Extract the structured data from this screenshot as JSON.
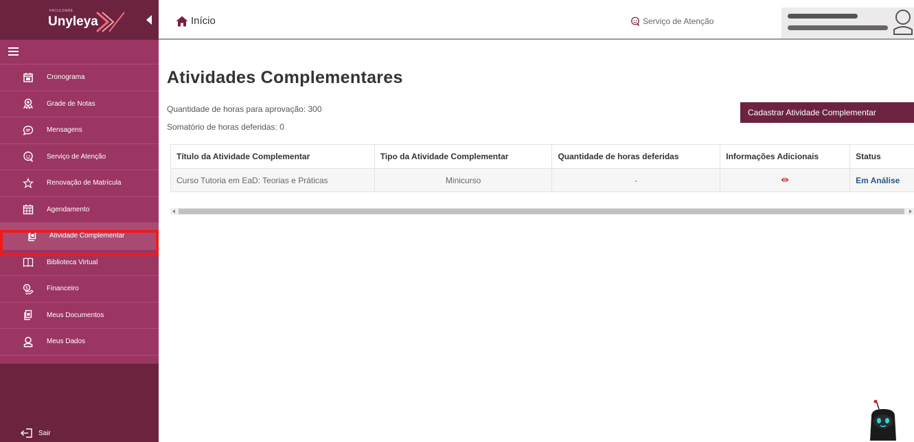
{
  "brand": {
    "small": "FACULDADE",
    "name": "Unyleya"
  },
  "sidebar": {
    "items": [
      {
        "label": "Cronograma",
        "icon": "calendar-icon"
      },
      {
        "label": "Grade de Notas",
        "icon": "award-icon"
      },
      {
        "label": "Mensagens",
        "icon": "chat-icon"
      },
      {
        "label": "Serviço de Atenção",
        "icon": "support-chat-icon"
      },
      {
        "label": "Renovação de Matrícula",
        "icon": "star-icon"
      },
      {
        "label": "Agendamento",
        "icon": "calendar-grid-icon"
      },
      {
        "label": "Atividade Complementar",
        "icon": "documents-icon",
        "active": true
      },
      {
        "label": "Biblioteca Virtual",
        "icon": "book-icon"
      },
      {
        "label": "Financeiro",
        "icon": "money-icon"
      },
      {
        "label": "Meus Documentos",
        "icon": "documents-icon"
      },
      {
        "label": "Meus Dados",
        "icon": "user-icon"
      }
    ],
    "logout_label": "Sair"
  },
  "topbar": {
    "home_label": "Início",
    "service_label": "Serviço de Atenção"
  },
  "main": {
    "title": "Atividades Complementares",
    "hours_required": "Quantidade de horas para aprovação: 300",
    "hours_granted": "Somatório de horas deferidas: 0",
    "register_button": "Cadastrar Atividade Complementar",
    "table": {
      "headers": [
        "Título da Atividade Complementar",
        "Tipo da Atividade Complementar",
        "Quantidade de horas deferidas",
        "Informações Adicionais",
        "Status"
      ],
      "rows": [
        {
          "title": "Curso Tutoria em EaD: Teorias e Práticas",
          "type": "Minicurso",
          "hours": "-",
          "status": "Em Análise"
        }
      ]
    }
  },
  "colors": {
    "sidebar": "#9b3562",
    "sidebar_dark": "#6b2340",
    "highlight": "#f01a1a",
    "status": "#2a5784"
  }
}
